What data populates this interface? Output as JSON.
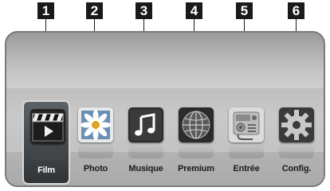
{
  "callouts": [
    "1",
    "2",
    "3",
    "4",
    "5",
    "6"
  ],
  "menu": {
    "selected_index": 0,
    "items": [
      {
        "label": "Film",
        "icon": "film-clapper-icon"
      },
      {
        "label": "Photo",
        "icon": "photo-flower-icon"
      },
      {
        "label": "Musique",
        "icon": "music-note-icon"
      },
      {
        "label": "Premium",
        "icon": "premium-globe-icon"
      },
      {
        "label": "Entrée",
        "icon": "input-device-icon"
      },
      {
        "label": "Config.",
        "icon": "settings-gear-icon"
      }
    ]
  },
  "colors": {
    "badge": "#1a1a1a",
    "selected_bg": "#3f4447",
    "screen_bg": "#c0c0c0"
  }
}
